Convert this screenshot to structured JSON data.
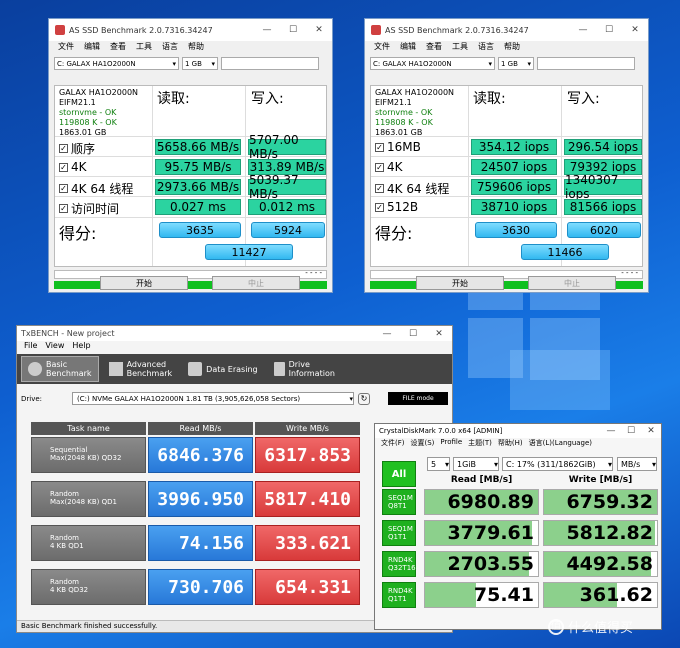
{
  "asssd_left": {
    "title": "AS SSD Benchmark 2.0.7316.34247",
    "menu": [
      "文件",
      "编辑",
      "查看",
      "工具",
      "语言",
      "帮助"
    ],
    "drive_select": "C:  GALAX HA1O2000N",
    "size_select": "1 GB",
    "info": {
      "model": "GALAX HA1O2000N",
      "firmware": "EIFM21.1",
      "driver": "stornvme - OK",
      "align": "119808 K - OK",
      "capacity": "1863.01 GB"
    },
    "col_read": "读取:",
    "col_write": "写入:",
    "rows": [
      {
        "label": "顺序",
        "read": "5658.66 MB/s",
        "write": "5707.00 MB/s"
      },
      {
        "label": "4K",
        "read": "95.75 MB/s",
        "write": "313.89 MB/s"
      },
      {
        "label": "4K 64 线程",
        "read": "2973.66 MB/s",
        "write": "5039.37 MB/s"
      },
      {
        "label": "访问时间",
        "read": "0.027 ms",
        "write": "0.012 ms"
      }
    ],
    "score_label": "得分:",
    "score_read": "3635",
    "score_write": "5924",
    "score_total": "11427",
    "dashes": "- - - -",
    "btn_start": "开始",
    "btn_stop": "中止"
  },
  "asssd_right": {
    "title": "AS SSD Benchmark 2.0.7316.34247",
    "menu": [
      "文件",
      "编辑",
      "查看",
      "工具",
      "语言",
      "帮助"
    ],
    "drive_select": "C:  GALAX HA1O2000N",
    "size_select": "1 GB",
    "info": {
      "model": "GALAX HA1O2000N",
      "firmware": "EIFM21.1",
      "driver": "stornvme - OK",
      "align": "119808 K - OK",
      "capacity": "1863.01 GB"
    },
    "col_read": "读取:",
    "col_write": "写入:",
    "rows": [
      {
        "label": "16MB",
        "read": "354.12 iops",
        "write": "296.54 iops"
      },
      {
        "label": "4K",
        "read": "24507 iops",
        "write": "79392 iops"
      },
      {
        "label": "4K 64 线程",
        "read": "759606 iops",
        "write": "1340307 iops"
      },
      {
        "label": "512B",
        "read": "38710 iops",
        "write": "81566 iops"
      }
    ],
    "score_label": "得分:",
    "score_read": "3630",
    "score_write": "6020",
    "score_total": "11466",
    "dashes": "- - - -",
    "btn_start": "开始",
    "btn_stop": "中止"
  },
  "txbench": {
    "title": "TxBENCH - New project",
    "menu": [
      "File",
      "View",
      "Help"
    ],
    "tabs": [
      {
        "line1": "Basic",
        "line2": "Benchmark"
      },
      {
        "line1": "Advanced",
        "line2": "Benchmark"
      },
      {
        "line1": "Data Erasing",
        "line2": ""
      },
      {
        "line1": "Drive",
        "line2": "Information"
      }
    ],
    "drive_label": "Drive:",
    "drive_value": "(C:) NVMe GALAX HA1O2000N  1.81 TB (3,905,626,058 Sectors)",
    "file_mode": "FILE mode",
    "col_task": "Task name",
    "col_read": "Read MB/s",
    "col_write": "Write MB/s",
    "rows": [
      {
        "name1": "Sequential",
        "name2": "Max(2048 KB) QD32",
        "read": "6846.376",
        "write": "6317.853"
      },
      {
        "name1": "Random",
        "name2": "Max(2048 KB) QD1",
        "read": "3996.950",
        "write": "5817.410"
      },
      {
        "name1": "Random",
        "name2": "4 KB QD1",
        "read": "74.156",
        "write": "333.621"
      },
      {
        "name1": "Random",
        "name2": "4 KB QD32",
        "read": "730.706",
        "write": "654.331"
      }
    ],
    "status": "Basic Benchmark finished successfully."
  },
  "cdm": {
    "title": "CrystalDiskMark 7.0.0 x64 [ADMIN]",
    "menu": [
      "文件(F)",
      "设置(S)",
      "Profile",
      "主题(T)",
      "帮助(H)",
      "语言(L)(Language)"
    ],
    "all_label": "All",
    "count": "5",
    "size": "1GiB",
    "drive": "C: 17% (311/1862GiB)",
    "unit": "MB/s",
    "col_read": "Read [MB/s]",
    "col_write": "Write [MB/s]",
    "rows": [
      {
        "l1": "SEQ1M",
        "l2": "Q8T1",
        "read": "6980.89",
        "write": "6759.32",
        "read_fill": 1.0,
        "write_fill": 1.0
      },
      {
        "l1": "SEQ1M",
        "l2": "Q1T1",
        "read": "3779.61",
        "write": "5812.82",
        "read_fill": 0.95,
        "write_fill": 0.98
      },
      {
        "l1": "RND4K",
        "l2": "Q32T16",
        "read": "2703.55",
        "write": "4492.58",
        "read_fill": 0.92,
        "write_fill": 0.95
      },
      {
        "l1": "RND4K",
        "l2": "Q1T1",
        "read": "75.41",
        "write": "361.62",
        "read_fill": 0.45,
        "write_fill": 0.65
      }
    ]
  },
  "watermark": "什么值得买"
}
